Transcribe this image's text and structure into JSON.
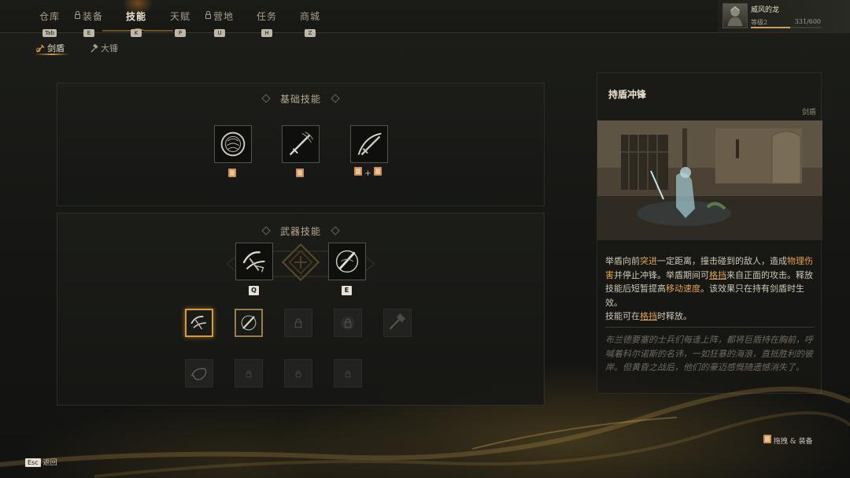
{
  "nav": {
    "tabs": [
      {
        "label": "仓库",
        "key": "Tab",
        "locked": false,
        "active": false
      },
      {
        "label": "装备",
        "key": "E",
        "locked": true,
        "active": false
      },
      {
        "label": "技能",
        "key": "K",
        "locked": false,
        "active": true
      },
      {
        "label": "天赋",
        "key": "P",
        "locked": false,
        "active": false
      },
      {
        "label": "营地",
        "key": "U",
        "locked": true,
        "active": false
      },
      {
        "label": "任务",
        "key": "H",
        "locked": false,
        "active": false
      },
      {
        "label": "商城",
        "key": "Z",
        "locked": false,
        "active": false
      }
    ]
  },
  "player": {
    "name": "威风的龙",
    "level": "等级2",
    "xp_text": "331/600",
    "xp_fraction": 0.55
  },
  "weapon_tabs": [
    {
      "label": "剑盾",
      "active": true,
      "icon": "sword-shield-icon"
    },
    {
      "label": "大锤",
      "active": false,
      "icon": "hammer-icon"
    }
  ],
  "basic_skills": {
    "title": "基础技能",
    "plus": "+",
    "skills": [
      {
        "icon": "round-shield-icon"
      },
      {
        "icon": "sword-thrust-icon"
      },
      {
        "icon": "sword-slash-icon"
      }
    ]
  },
  "weapon_skills": {
    "title": "武器技能",
    "equipped": [
      {
        "icon": "shield-charge-icon",
        "key": "Q"
      },
      {
        "icon": "blade-spin-icon",
        "key": "E"
      }
    ],
    "row1": [
      {
        "icon": "shield-charge-icon",
        "state": "selected"
      },
      {
        "icon": "blade-spin-icon",
        "state": "equipped"
      },
      {
        "icon": "lock-icon",
        "state": "locked"
      },
      {
        "icon": "lock-icon",
        "state": "locked"
      },
      {
        "icon": "hammer-strike-icon",
        "state": "locked"
      }
    ],
    "row2": [
      {
        "icon": "whirlwind-icon",
        "state": "locked"
      },
      {
        "icon": "lock-icon",
        "state": "locked"
      },
      {
        "icon": "lock-icon",
        "state": "locked"
      },
      {
        "icon": "lock-icon",
        "state": "locked"
      }
    ]
  },
  "detail": {
    "title": "持盾冲锋",
    "category": "剑盾",
    "desc": {
      "p1_a": "举盾向前",
      "p1_hl1": "突进",
      "p1_b": "一定距离，撞击碰到的敌人，造成",
      "p1_hl2": "物理伤害",
      "p1_c": "并停止冲锋。举盾期间可",
      "p1_ul1": "格挡",
      "p1_d": "来自正面的攻击。释放技能后短暂提高",
      "p1_hl3": "移动速度",
      "p1_e": "。该效果只在持有剑盾时生效。",
      "p2_a": "技能可在",
      "p2_ul": "格挡",
      "p2_b": "时释放。"
    },
    "lore": "布兰德要塞的士兵们每逢上阵，都将巨盾持在胸前，呼喊着科尔诺斯的名讳，一如狂暴的海浪，直抵胜利的彼岸。但黄昏之战后，他们的豪迈感慨随遗憾消失了。"
  },
  "hints": {
    "drag_equip": "拖拽 & 装备",
    "esc_key": "Esc",
    "back": "返回"
  },
  "colors": {
    "accent": "#d89a3a",
    "highlight_text": "#e0a254",
    "background": "#161714"
  }
}
